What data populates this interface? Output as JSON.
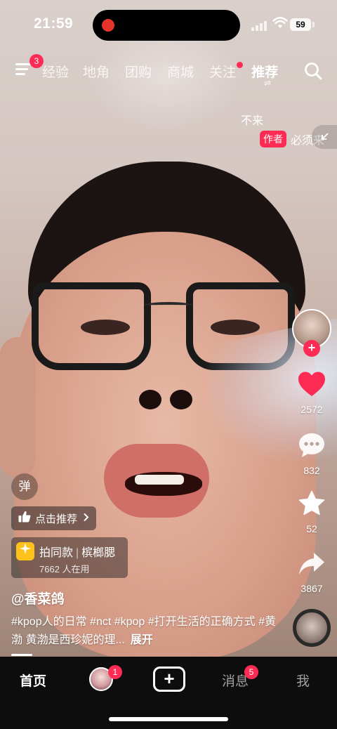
{
  "status_bar": {
    "time": "21:59",
    "battery": "59"
  },
  "top_nav": {
    "menu_badge": "3",
    "tabs": [
      {
        "label": "经验"
      },
      {
        "label": "地角"
      },
      {
        "label": "团购"
      },
      {
        "label": "商城"
      },
      {
        "label": "关注"
      },
      {
        "label": "推荐"
      }
    ],
    "active_tab": "推荐",
    "swap_glyph": "⇌"
  },
  "danmaku": {
    "line1": "不来",
    "author_tag": "作者",
    "line2": "必须来"
  },
  "actions": {
    "likes": "2572",
    "comments": "832",
    "favorites": "52",
    "shares": "3867",
    "follow_plus": "+"
  },
  "overlay": {
    "danmaku_button": "弹",
    "recommend_label": "点击推荐",
    "same_style_title": "拍同款",
    "same_style_name": "槟榔腮",
    "same_style_sep": "|",
    "same_style_users": "7662 人在用",
    "username": "@香菜鸽",
    "caption": "#kpop人的日常 #nct #kpop #打开生活的正确方式 #黄渤 黄渤是西珍妮的理...",
    "expand": "展开"
  },
  "bottom_nav": {
    "home": "首页",
    "friend_badge": "1",
    "create": "+",
    "messages": "消息",
    "messages_badge": "5",
    "me": "我"
  },
  "colors": {
    "accent": "#fe2c55",
    "tab_bar": "#0d0d0d",
    "sparkle": "#ffc21a"
  }
}
